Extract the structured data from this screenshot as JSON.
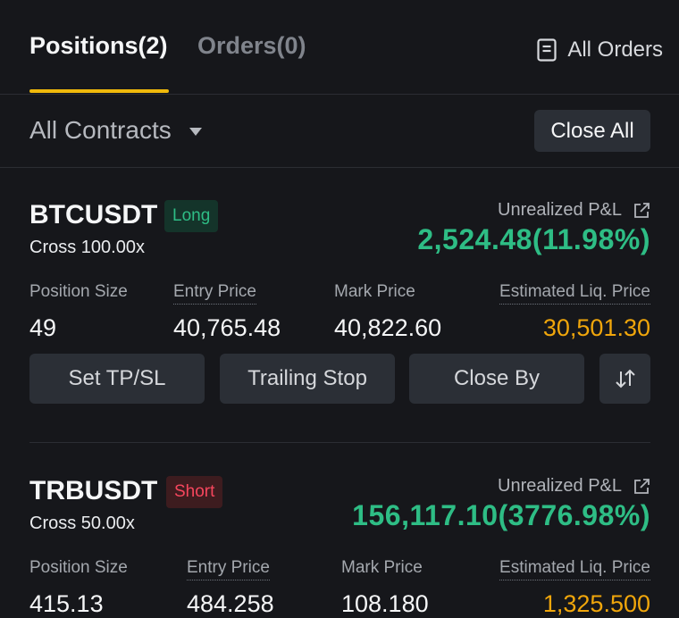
{
  "tabs": {
    "positions": "Positions(2)",
    "orders": "Orders(0)",
    "all_orders": "All Orders"
  },
  "filter": {
    "contracts": "All Contracts",
    "close_all": "Close All"
  },
  "labels": {
    "unrealized_pnl": "Unrealized P&L",
    "position_size": "Position Size",
    "entry_price": "Entry Price",
    "mark_price": "Mark Price",
    "est_liq_price": "Estimated Liq. Price"
  },
  "positions": [
    {
      "symbol": "BTCUSDT",
      "side": "Long",
      "margin": "Cross 100.00x",
      "pnl": "2,524.48(11.98%)",
      "size": "49",
      "entry": "40,765.48",
      "mark": "40,822.60",
      "liq": "30,501.30",
      "buttons": {
        "tpsl": "Set TP/SL",
        "trailing": "Trailing Stop",
        "close_by": "Close By"
      }
    },
    {
      "symbol": "TRBUSDT",
      "side": "Short",
      "margin": "Cross 50.00x",
      "pnl": "156,117.10(3776.98%)",
      "size": "415.13",
      "entry": "484.258",
      "mark": "108.180",
      "liq": "1,325.500"
    }
  ],
  "colors": {
    "accent": "#f0b90b",
    "profit": "#2ebd85",
    "loss": "#f6465d",
    "liq": "#f0a60b"
  },
  "icons": {
    "all_orders": "document-list-icon",
    "pnl_share": "external-link-icon",
    "reverse": "swap-arrows-icon",
    "dropdown": "caret-down-icon"
  }
}
